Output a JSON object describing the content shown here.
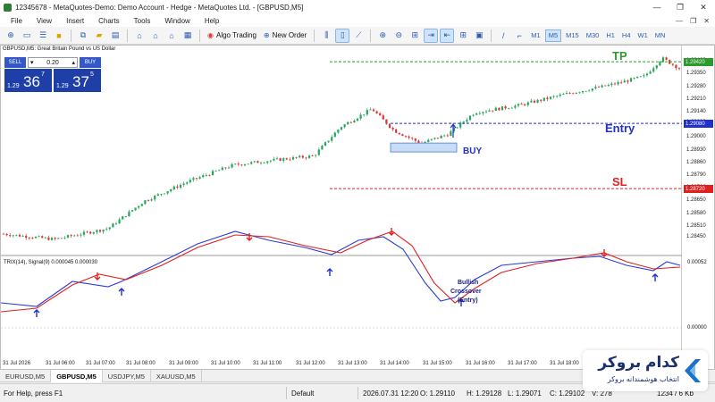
{
  "window": {
    "title": "12345678 - MetaQuotes-Demo: Demo Account - Hedge - MetaQuotes Ltd. - [GBPUSD,M5]",
    "controls": [
      "—",
      "❐",
      "✕"
    ]
  },
  "menu": {
    "items": [
      "File",
      "View",
      "Insert",
      "Charts",
      "Tools",
      "Window",
      "Help"
    ],
    "mdi_controls": [
      "—",
      "❐",
      "✕"
    ]
  },
  "toolbar": {
    "algo_trading": "Algo Trading",
    "new_order": "New Order",
    "timeframes": [
      "M1",
      "M5",
      "M15",
      "M30",
      "H1",
      "H4",
      "W1",
      "MN"
    ],
    "active_timeframe": "M5"
  },
  "trade_panel": {
    "sell_label": "SELL",
    "buy_label": "BUY",
    "lot": "0.20",
    "sell_small": "1.29",
    "sell_big": "36",
    "sell_sup": "7",
    "buy_small": "1.29",
    "buy_big": "37",
    "buy_sup": "5"
  },
  "chart": {
    "title": "GBPUSD,M5:  Great Britain Pound vs US Dollar",
    "oscillator_title": "TRIX(14), Signal(9) 0.000045 0.000030",
    "colors": {
      "bull": "#26a65b",
      "bear": "#d93636",
      "trix": "#2b3bd6",
      "signal": "#e02020",
      "tp": "#2e9a2e",
      "entry": "#2030c8",
      "sl": "#e02020"
    }
  },
  "chart_data": {
    "type": "candlestick",
    "price_axis": [
      "1.29420",
      "1.29350",
      "1.29280",
      "1.29210",
      "1.29140",
      "1.29080",
      "1.29000",
      "1.28930",
      "1.28860",
      "1.28790",
      "1.28720",
      "1.28650",
      "1.28580",
      "1.28510",
      "1.28450"
    ],
    "price_range": [
      1.284,
      1.2948
    ],
    "levels": {
      "tp": {
        "label": "TP",
        "price": "1.29420"
      },
      "entry": {
        "label": "Entry",
        "price": "1.29080"
      },
      "sl": {
        "label": "SL",
        "price": "1.28720"
      }
    },
    "buy_annotation": "BUY",
    "oscillator_axis": {
      "top": "0.00052",
      "zero": "0.00000"
    },
    "crossover_annotation": [
      "Bullish",
      "Crossover",
      "(Entry)"
    ],
    "x_labels": [
      "31 Jul 2026",
      "31 Jul 06:00",
      "31 Jul 07:00",
      "31 Jul 08:00",
      "31 Jul 09:00",
      "31 Jul 10:00",
      "31 Jul 11:00",
      "31 Jul 12:00",
      "31 Jul 13:00",
      "31 Jul 14:00",
      "31 Jul 15:00",
      "31 Jul 16:00",
      "31 Jul 17:00",
      "31 Jul 18:00"
    ]
  },
  "tabs": [
    "EURUSD,M5",
    "GBPUSD,M5",
    "USDJPY,M5",
    "XAUUSD,M5"
  ],
  "active_tab": "GBPUSD,M5",
  "status": {
    "help": "For Help, press F1",
    "profile": "Default",
    "datetime": "2026.07.31 12:20",
    "open": "O: 1.29110",
    "high": "H: 1.29128",
    "low": "L: 1.29071",
    "close": "C: 1.29102",
    "volume": "V: 278",
    "traffic": "1234 / 6 Kb"
  },
  "brand": {
    "name": "کدام بروکر",
    "tagline": "انتخاب هوشمندانه بروکر",
    "color": "#1a2f6b"
  }
}
